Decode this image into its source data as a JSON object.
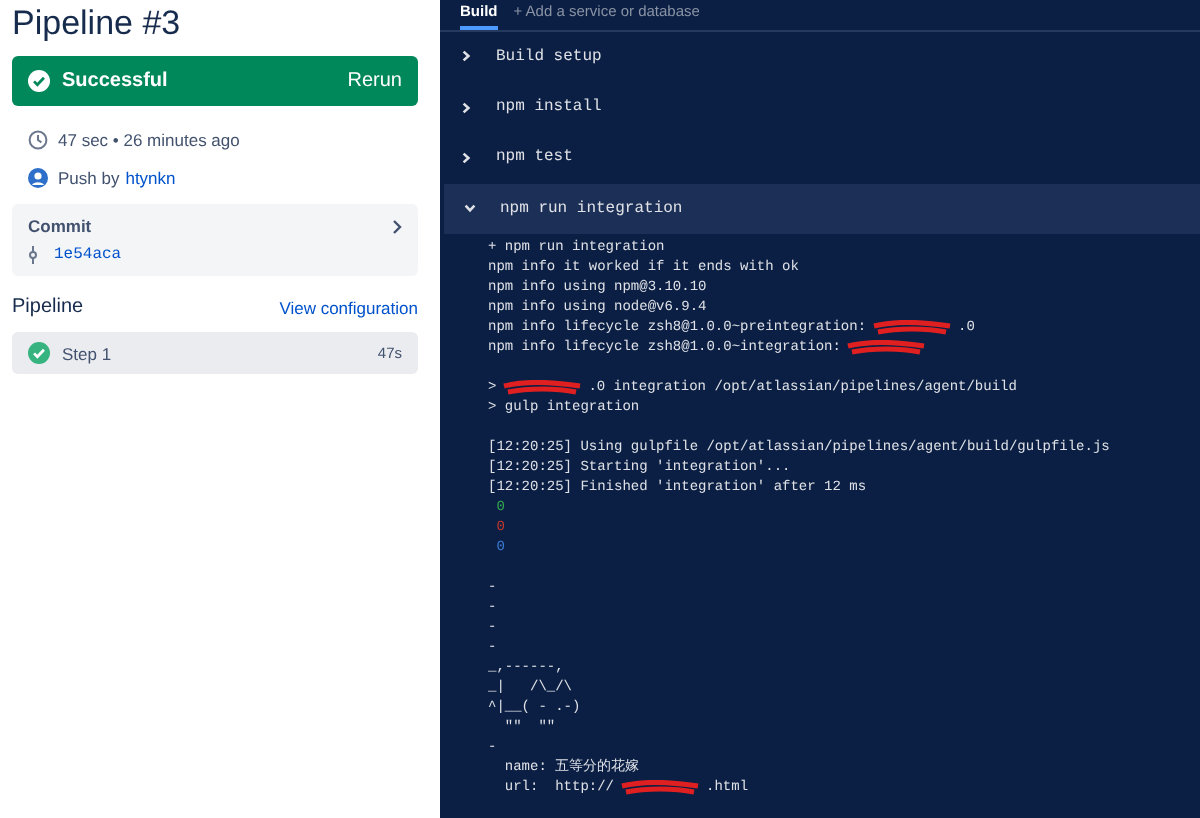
{
  "title": "Pipeline #3",
  "status": {
    "label": "Successful",
    "action": "Rerun"
  },
  "meta": {
    "duration": "47 sec • 26 minutes ago",
    "push_prefix": "Push by",
    "user": "htynkn"
  },
  "commit": {
    "heading": "Commit",
    "hash": "1e54aca"
  },
  "pipeline": {
    "heading": "Pipeline",
    "link": "View configuration",
    "steps": [
      {
        "name": "Step 1",
        "time": "47s",
        "selected": true
      }
    ]
  },
  "tabs": [
    {
      "label": "Build",
      "selected": true
    },
    {
      "label": "+ Add a service or database",
      "selected": false
    }
  ],
  "sections": [
    {
      "title": "Build setup",
      "expanded": false
    },
    {
      "title": "npm install",
      "expanded": false
    },
    {
      "title": "npm test",
      "expanded": false
    },
    {
      "title": "npm run integration",
      "expanded": true
    }
  ],
  "log_blocks": [
    {
      "lines": [
        {
          "text": "+ npm run integration"
        },
        {
          "text": "npm info it worked if it ends with ok"
        },
        {
          "text": "npm info using npm@3.10.10"
        },
        {
          "text": "npm info using node@v6.9.4"
        },
        {
          "text": "npm info lifecycle zsh8@1.0.0~preintegration:",
          "redacted": true,
          "after": ".0"
        },
        {
          "text": "npm info lifecycle zsh8@1.0.0~integration:",
          "redacted": true
        }
      ]
    },
    {
      "lines": [
        {
          "text": ">",
          "redacted": true,
          "after": ".0 integration /opt/atlassian/pipelines/agent/build"
        },
        {
          "text": "> gulp integration"
        }
      ]
    },
    {
      "lines": [
        {
          "text": "[12:20:25] Using gulpfile /opt/atlassian/pipelines/agent/build/gulpfile.js"
        },
        {
          "text": "[12:20:25] Starting 'integration'..."
        },
        {
          "text": "[12:20:25] Finished 'integration' after 12 ms"
        },
        {
          "text": " 0",
          "color": "#2fa84f"
        },
        {
          "text": " 0",
          "color": "#c0392b"
        },
        {
          "text": " 0",
          "color": "#3a7bd5"
        }
      ]
    },
    {
      "lines": [
        {
          "text": "-"
        },
        {
          "text": "-"
        },
        {
          "text": "-"
        },
        {
          "text": "-"
        },
        {
          "text": "_,------,"
        },
        {
          "text": "_|   /\\_/\\"
        },
        {
          "text": "^|__( - .-)"
        },
        {
          "text": "  \"\"  \"\""
        },
        {
          "text": "-"
        },
        {
          "text": "  name: 五等分的花嫁"
        },
        {
          "text": "  url:  http://",
          "redacted": true,
          "after": ".html"
        }
      ]
    }
  ]
}
